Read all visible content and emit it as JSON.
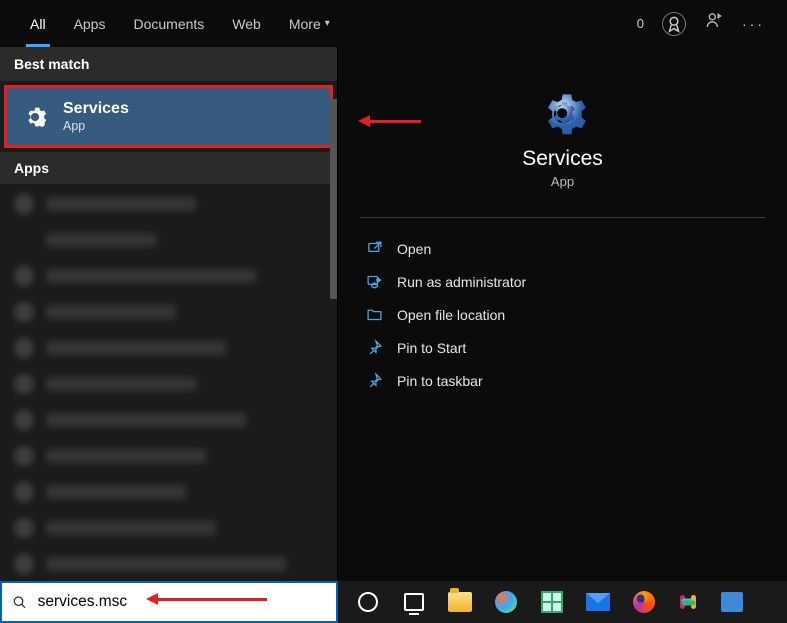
{
  "tabs": {
    "all": "All",
    "apps": "Apps",
    "documents": "Documents",
    "web": "Web",
    "more": "More"
  },
  "top": {
    "zero": "0"
  },
  "left": {
    "best_match": "Best match",
    "result": {
      "title": "Services",
      "subtitle": "App"
    },
    "apps_header": "Apps"
  },
  "preview": {
    "title": "Services",
    "subtitle": "App",
    "actions": {
      "open": "Open",
      "admin": "Run as administrator",
      "openloc": "Open file location",
      "pinstart": "Pin to Start",
      "pintask": "Pin to taskbar"
    }
  },
  "search": {
    "value": "services.msc"
  }
}
